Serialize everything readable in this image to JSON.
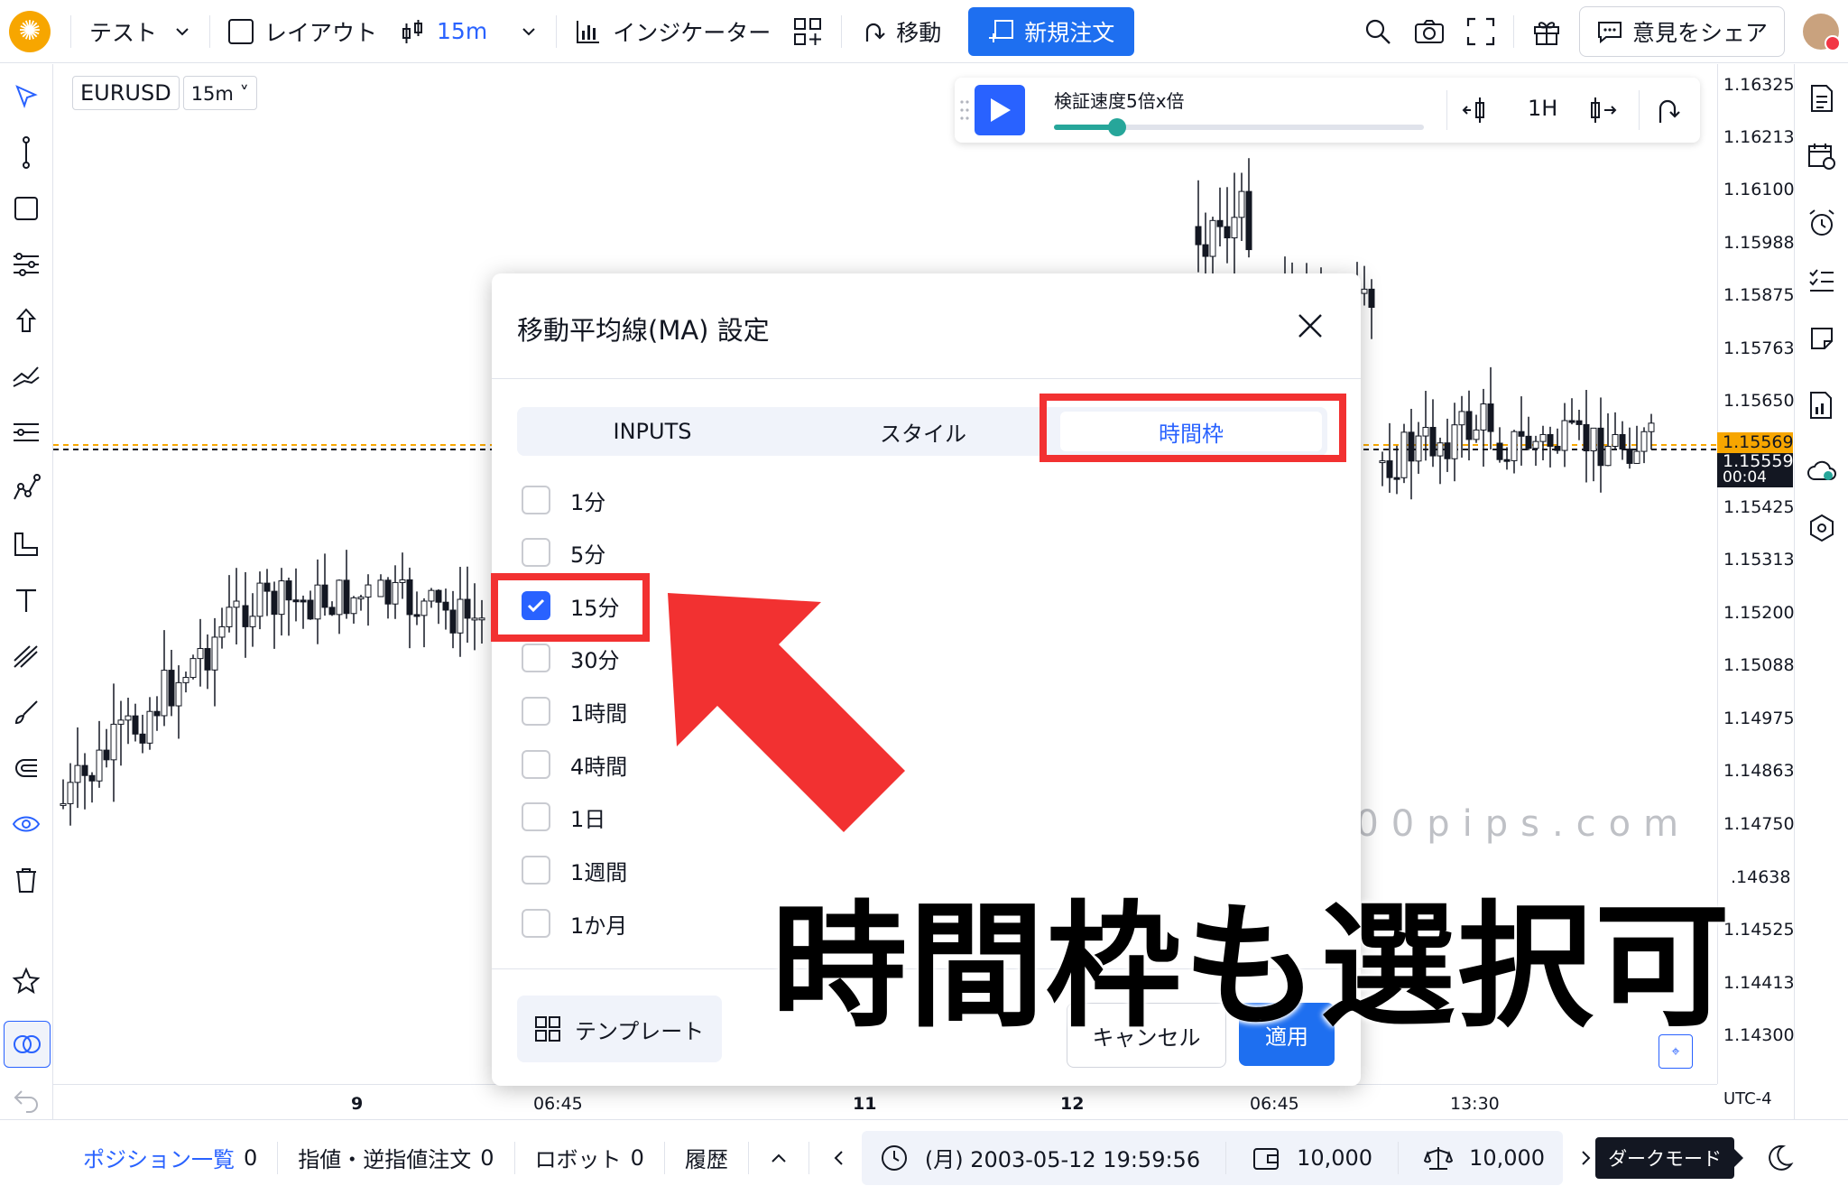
{
  "topbar": {
    "workspace_name": "テスト",
    "layout_label": "レイアウト",
    "interval": "15m",
    "indicators_label": "インジケーター",
    "move_label": "移動",
    "new_order_label": "新規注文",
    "feedback_label": "意見をシェア"
  },
  "symbol": {
    "ticker": "EURUSD",
    "interval": "15m ˅"
  },
  "replay": {
    "speed_label": "検証速度5倍x倍",
    "timeframe": "1H",
    "speed_fraction": 0.17
  },
  "price_axis": {
    "labels": [
      "1.16325",
      "1.16213",
      "1.16100",
      "1.15988",
      "1.15875",
      "1.15763",
      "1.15650",
      "1.15425",
      "1.15313",
      "1.15200",
      "1.15088",
      "1.14975",
      "1.14863",
      "1.14750",
      ".14638",
      "1.14525",
      "1.14413",
      "1.14300"
    ],
    "current_price": "1.15569",
    "last_price": "1.15559",
    "countdown": "00:04",
    "timezone": "UTC-4"
  },
  "time_axis": {
    "labels": [
      "9",
      "06:45",
      "11",
      "12",
      "06:45",
      "13:30"
    ]
  },
  "modal": {
    "title": "移動平均線(MA) 設定",
    "tabs": [
      "INPUTS",
      "スタイル",
      "時間枠"
    ],
    "active_tab": 2,
    "timeframes": [
      {
        "label": "1分",
        "checked": false
      },
      {
        "label": "5分",
        "checked": false
      },
      {
        "label": "15分",
        "checked": true
      },
      {
        "label": "30分",
        "checked": false
      },
      {
        "label": "1時間",
        "checked": false
      },
      {
        "label": "4時間",
        "checked": false
      },
      {
        "label": "1日",
        "checked": false
      },
      {
        "label": "1週間",
        "checked": false
      },
      {
        "label": "1か月",
        "checked": false
      }
    ],
    "template_label": "テンプレート",
    "cancel_label": "キャンセル",
    "apply_label": "適用"
  },
  "bottombar": {
    "positions_label": "ポジション一覧",
    "positions_count": "0",
    "orders_label": "指値・逆指値注文",
    "orders_count": "0",
    "robot_label": "ロボット",
    "robot_count": "0",
    "history_label": "履歴",
    "datetime": "(月) 2003-05-12 19:59:56",
    "balance": "10,000",
    "equity": "10,000",
    "darkmode_label": "ダークモード"
  },
  "annotation": {
    "caption": "時間枠も選択可",
    "watermark": "https://gekkan200pips.com"
  },
  "colors": {
    "accent": "#2962ff",
    "annotation_red": "#f23131",
    "candle_up": "#ffffff",
    "candle_down": "#131722",
    "price_line": "#f7a600"
  }
}
